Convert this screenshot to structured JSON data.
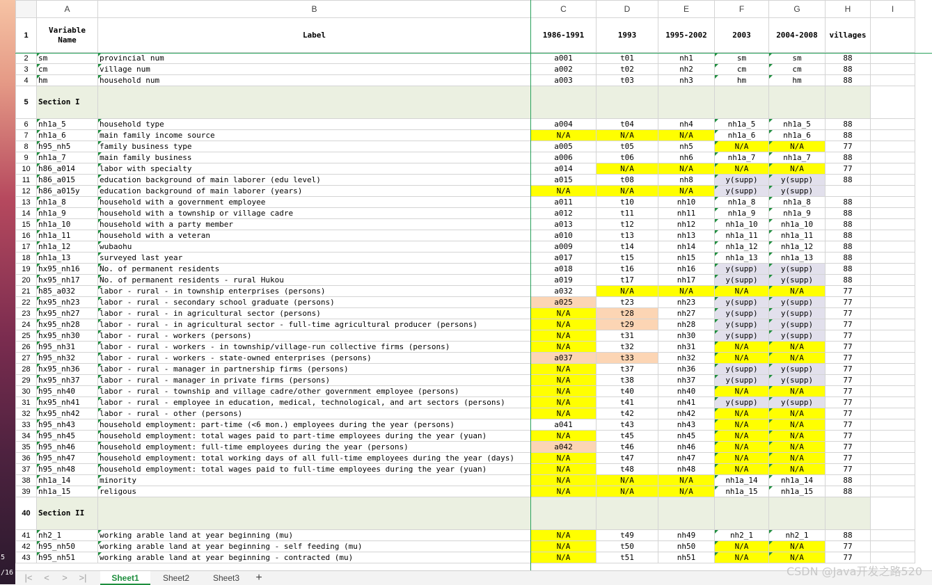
{
  "column_headers": [
    "A",
    "B",
    "C",
    "D",
    "E",
    "F",
    "G",
    "H",
    "I"
  ],
  "left_edge": {
    "top": "5",
    "bottom": "/16"
  },
  "header_row": {
    "num": "1",
    "cells": [
      "Variable Name",
      "Label",
      "1986-1991",
      "1993",
      "1995-2002",
      "2003",
      "2004-2008",
      "villages",
      ""
    ]
  },
  "rows": [
    {
      "num": "2",
      "a": "sm",
      "b": "provincial num",
      "c": "a001",
      "d": "t01",
      "e": "nh1",
      "f": "sm",
      "g": "sm",
      "h": "88"
    },
    {
      "num": "3",
      "a": "cm",
      "b": "village num",
      "c": "a002",
      "d": "t02",
      "e": "nh2",
      "f": "cm",
      "g": "cm",
      "h": "88"
    },
    {
      "num": "4",
      "a": "hm",
      "b": "household num",
      "c": "a003",
      "d": "t03",
      "e": "nh3",
      "f": "hm",
      "g": "hm",
      "h": "88"
    },
    {
      "num": "5",
      "section": "Section I"
    },
    {
      "num": "6",
      "a": "nh1a_5",
      "b": "household type",
      "c": "a004",
      "d": "t04",
      "e": "nh4",
      "f": "nh1a_5",
      "g": "nh1a_5",
      "h": "88"
    },
    {
      "num": "7",
      "a": "nh1a_6",
      "b": "main family income source",
      "c": "N/A",
      "d": "N/A",
      "e": "N/A",
      "f": "nh1a_6",
      "g": "nh1a_6",
      "h": "88",
      "cc": "yellow",
      "dc": "yellow",
      "ec": "yellow"
    },
    {
      "num": "8",
      "a": "h95_nh5",
      "b": "family business type",
      "c": "a005",
      "d": "t05",
      "e": "nh5",
      "f": "N/A",
      "g": "N/A",
      "h": "77",
      "fc": "yellow",
      "gc": "yellow"
    },
    {
      "num": "9",
      "a": "nh1a_7",
      "b": "main family business",
      "c": "a006",
      "d": "t06",
      "e": "nh6",
      "f": "nh1a_7",
      "g": "nh1a_7",
      "h": "88"
    },
    {
      "num": "10",
      "a": "h86_a014",
      "b": "labor with specialty",
      "c": "a014",
      "d": "N/A",
      "e": "N/A",
      "f": "N/A",
      "g": "N/A",
      "h": "77",
      "dc": "yellow",
      "ec": "yellow",
      "fc": "yellow",
      "gc": "yellow"
    },
    {
      "num": "11",
      "a": "h86_a015",
      "b": "education background of main laborer (edu level)",
      "c": "a015",
      "d": "t08",
      "e": "nh8",
      "f": "y(supp)",
      "g": "y(supp)",
      "h": "88",
      "fc": "lav",
      "gc": "lav"
    },
    {
      "num": "12",
      "a": "h86_a015y",
      "b": "education background of main laborer (years)",
      "c": "N/A",
      "d": "N/A",
      "e": "N/A",
      "f": "y(supp)",
      "g": "y(supp)",
      "h": "",
      "cc": "yellow",
      "dc": "yellow",
      "ec": "yellow",
      "fc": "lav",
      "gc": "lav"
    },
    {
      "num": "13",
      "a": "nh1a_8",
      "b": "household with a government employee",
      "c": "a011",
      "d": "t10",
      "e": "nh10",
      "f": "nh1a_8",
      "g": "nh1a_8",
      "h": "88"
    },
    {
      "num": "14",
      "a": "nh1a_9",
      "b": "household with a township or village cadre",
      "c": "a012",
      "d": "t11",
      "e": "nh11",
      "f": "nh1a_9",
      "g": "nh1a_9",
      "h": "88"
    },
    {
      "num": "15",
      "a": "nh1a_10",
      "b": "household with a party member",
      "c": "a013",
      "d": "t12",
      "e": "nh12",
      "f": "nh1a_10",
      "g": "nh1a_10",
      "h": "88"
    },
    {
      "num": "16",
      "a": "nh1a_11",
      "b": "household with a veteran",
      "c": "a010",
      "d": "t13",
      "e": "nh13",
      "f": "nh1a_11",
      "g": "nh1a_11",
      "h": "88"
    },
    {
      "num": "17",
      "a": "nh1a_12",
      "b": "wubaohu",
      "c": "a009",
      "d": "t14",
      "e": "nh14",
      "f": "nh1a_12",
      "g": "nh1a_12",
      "h": "88"
    },
    {
      "num": "18",
      "a": "nh1a_13",
      "b": "surveyed last year",
      "c": "a017",
      "d": "t15",
      "e": "nh15",
      "f": "nh1a_13",
      "g": "nh1a_13",
      "h": "88"
    },
    {
      "num": "19",
      "a": "hx95_nh16",
      "b": "No. of permanent residents",
      "c": "a018",
      "d": "t16",
      "e": "nh16",
      "f": "y(supp)",
      "g": "y(supp)",
      "h": "88",
      "fc": "lav",
      "gc": "lav"
    },
    {
      "num": "20",
      "a": "hx95_nh17",
      "b": "No. of permanent residents - rural Hukou",
      "c": "a019",
      "d": "t17",
      "e": "nh17",
      "f": "y(supp)",
      "g": "y(supp)",
      "h": "88",
      "fc": "lav",
      "gc": "lav"
    },
    {
      "num": "21",
      "a": "h85_a032",
      "b": "labor - rural - in township enterprises (persons)",
      "c": "a032",
      "d": "N/A",
      "e": "N/A",
      "f": "N/A",
      "g": "N/A",
      "h": "77",
      "dc": "yellow",
      "ec": "yellow",
      "fc": "yellow",
      "gc": "yellow"
    },
    {
      "num": "22",
      "a": "hx95_nh23",
      "b": "labor - rural - secondary school graduate (persons)",
      "c": "a025",
      "d": "t23",
      "e": "nh23",
      "f": "y(supp)",
      "g": "y(supp)",
      "h": "77",
      "cc": "peach",
      "fc": "lav",
      "gc": "lav"
    },
    {
      "num": "23",
      "a": "hx95_nh27",
      "b": "labor - rural - in agricultural sector (persons)",
      "c": "N/A",
      "d": "t28",
      "e": "nh27",
      "f": "y(supp)",
      "g": "y(supp)",
      "h": "77",
      "cc": "yellow",
      "dc": "peach",
      "fc": "lav",
      "gc": "lav"
    },
    {
      "num": "24",
      "a": "hx95_nh28",
      "b": "labor - rural - in agricultural sector - full-time agricultural producer (persons)",
      "c": "N/A",
      "d": "t29",
      "e": "nh28",
      "f": "y(supp)",
      "g": "y(supp)",
      "h": "77",
      "cc": "yellow",
      "dc": "peach",
      "fc": "lav",
      "gc": "lav"
    },
    {
      "num": "25",
      "a": "hx95_nh30",
      "b": "labor - rural - workers (persons)",
      "c": "N/A",
      "d": "t31",
      "e": "nh30",
      "f": "y(supp)",
      "g": "y(supp)",
      "h": "77",
      "cc": "yellow",
      "fc": "lav",
      "gc": "lav"
    },
    {
      "num": "26",
      "a": "h95_nh31",
      "b": "labor - rural - workers - in township/village-run collective firms (persons)",
      "c": "N/A",
      "d": "t32",
      "e": "nh31",
      "f": "N/A",
      "g": "N/A",
      "h": "77",
      "cc": "yellow",
      "fc": "yellow",
      "gc": "yellow"
    },
    {
      "num": "27",
      "a": "h95_nh32",
      "b": "labor - rural - workers - state-owned enterprises (persons)",
      "c": "a037",
      "d": "t33",
      "e": "nh32",
      "f": "N/A",
      "g": "N/A",
      "h": "77",
      "cc": "peach",
      "dc": "peach",
      "fc": "yellow",
      "gc": "yellow"
    },
    {
      "num": "28",
      "a": "hx95_nh36",
      "b": "labor - rural - manager in partnership firms (persons)",
      "c": "N/A",
      "d": "t37",
      "e": "nh36",
      "f": "y(supp)",
      "g": "y(supp)",
      "h": "77",
      "cc": "yellow",
      "fc": "lav",
      "gc": "lav"
    },
    {
      "num": "29",
      "a": "hx95_nh37",
      "b": "labor - rural - manager in private firms (persons)",
      "c": "N/A",
      "d": "t38",
      "e": "nh37",
      "f": "y(supp)",
      "g": "y(supp)",
      "h": "77",
      "cc": "yellow",
      "fc": "lav",
      "gc": "lav"
    },
    {
      "num": "30",
      "a": "h95_nh40",
      "b": "labor - rural - township and village cadre/other government employee (persons)",
      "c": "N/A",
      "d": "t40",
      "e": "nh40",
      "f": "N/A",
      "g": "N/A",
      "h": "77",
      "cc": "yellow",
      "fc": "yellow",
      "gc": "yellow"
    },
    {
      "num": "31",
      "a": "hx95_nh41",
      "b": "labor - rural - employee in education, medical, technological, and art sectors (persons)",
      "c": "N/A",
      "d": "t41",
      "e": "nh41",
      "f": "y(supp)",
      "g": "y(supp)",
      "h": "77",
      "cc": "yellow",
      "fc": "lav",
      "gc": "lav"
    },
    {
      "num": "32",
      "a": "hx95_nh42",
      "b": "labor - rural - other (persons)",
      "c": "N/A",
      "d": "t42",
      "e": "nh42",
      "f": "N/A",
      "g": "N/A",
      "h": "77",
      "cc": "yellow",
      "fc": "yellow",
      "gc": "yellow"
    },
    {
      "num": "33",
      "a": "h95_nh43",
      "b": "household employment: part-time (<6 mon.) employees during the year (persons)",
      "c": "a041",
      "d": "t43",
      "e": "nh43",
      "f": "N/A",
      "g": "N/A",
      "h": "77",
      "fc": "yellow",
      "gc": "yellow"
    },
    {
      "num": "34",
      "a": "h95_nh45",
      "b": "household employment: total wages paid to part-time employees during the year (yuan)",
      "c": "N/A",
      "d": "t45",
      "e": "nh45",
      "f": "N/A",
      "g": "N/A",
      "h": "77",
      "cc": "yellow",
      "fc": "yellow",
      "gc": "yellow"
    },
    {
      "num": "35",
      "a": "h95_nh46",
      "b": "household employment: full-time employees during the year (persons)",
      "c": "a042",
      "d": "t46",
      "e": "nh46",
      "f": "N/A",
      "g": "N/A",
      "h": "77",
      "cc": "peach",
      "fc": "yellow",
      "gc": "yellow"
    },
    {
      "num": "36",
      "a": "h95_nh47",
      "b": "household employment: total working days of all full-time employees during the year (days)",
      "c": "N/A",
      "d": "t47",
      "e": "nh47",
      "f": "N/A",
      "g": "N/A",
      "h": "77",
      "cc": "yellow",
      "fc": "yellow",
      "gc": "yellow"
    },
    {
      "num": "37",
      "a": "h95_nh48",
      "b": "household employment: total wages paid to full-time employees during the year (yuan)",
      "c": "N/A",
      "d": "t48",
      "e": "nh48",
      "f": "N/A",
      "g": "N/A",
      "h": "77",
      "cc": "yellow",
      "fc": "yellow",
      "gc": "yellow"
    },
    {
      "num": "38",
      "a": "nh1a_14",
      "b": "minority",
      "c": "N/A",
      "d": "N/A",
      "e": "N/A",
      "f": "nh1a_14",
      "g": "nh1a_14",
      "h": "88",
      "cc": "yellow",
      "dc": "yellow",
      "ec": "yellow"
    },
    {
      "num": "39",
      "a": "nh1a_15",
      "b": "religous",
      "c": "N/A",
      "d": "N/A",
      "e": "N/A",
      "f": "nh1a_15",
      "g": "nh1a_15",
      "h": "88",
      "cc": "yellow",
      "dc": "yellow",
      "ec": "yellow"
    },
    {
      "num": "40",
      "section": "Section II"
    },
    {
      "num": "41",
      "a": "nh2_1",
      "b": "working arable land at year beginning (mu)",
      "c": "N/A",
      "d": "t49",
      "e": "nh49",
      "f": "nh2_1",
      "g": "nh2_1",
      "h": "88",
      "cc": "yellow"
    },
    {
      "num": "42",
      "a": "h95_nh50",
      "b": "working arable land at year beginning - self feeding (mu)",
      "c": "N/A",
      "d": "t50",
      "e": "nh50",
      "f": "N/A",
      "g": "N/A",
      "h": "77",
      "cc": "yellow",
      "fc": "yellow",
      "gc": "yellow"
    },
    {
      "num": "43",
      "a": "h95_nh51",
      "b": "working arable land at year beginning - contracted (mu)",
      "c": "N/A",
      "d": "t51",
      "e": "nh51",
      "f": "N/A",
      "g": "N/A",
      "h": "77",
      "cc": "yellow",
      "fc": "yellow",
      "gc": "yellow"
    }
  ],
  "tabs": [
    {
      "label": "Sheet1",
      "active": true
    },
    {
      "label": "Sheet2",
      "active": false
    },
    {
      "label": "Sheet3",
      "active": false
    }
  ],
  "add_tab_label": "+",
  "nav": {
    "first": "|<",
    "prev": "<",
    "next": ">",
    "last": ">|"
  },
  "watermark": "CSDN @Java开发之路520",
  "colors": {
    "na_yellow": "#ffff00",
    "peach": "#fcd5b4",
    "supp_lavender": "#e2e0ec",
    "section_band": "#ebf0e1",
    "freeze_green": "#27a05a"
  }
}
